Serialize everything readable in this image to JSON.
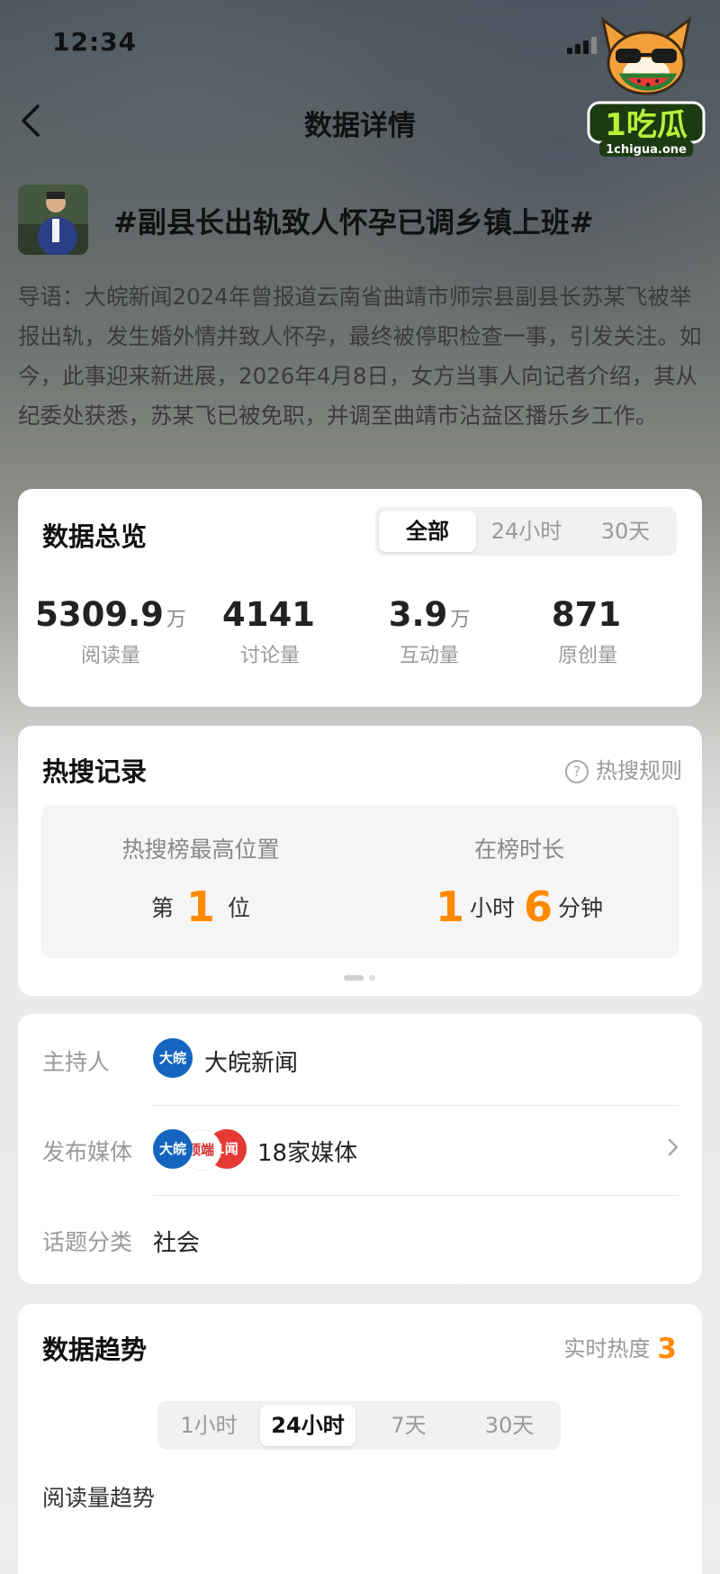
{
  "status_bar": {
    "time": "12:34"
  },
  "nav": {
    "title": "数据详情"
  },
  "logo": {
    "text": "1吃瓜",
    "subtext": "1chigua.one"
  },
  "topic": {
    "title": "#副县长出轨致人怀孕已调乡镇上班#",
    "intro": "导语：大皖新闻2024年曾报道云南省曲靖市师宗县副县长苏某飞被举报出轨，发生婚外情并致人怀孕，最终被停职检查一事，引发关注。如今，此事迎来新进展，2026年4月8日，女方当事人向记者介绍，其从纪委处获悉，苏某飞已被免职，并调至曲靖市沾益区播乐乡工作。"
  },
  "overview": {
    "title": "数据总览",
    "tabs": [
      "全部",
      "24小时",
      "30天"
    ],
    "active_tab": "全部",
    "stats": [
      {
        "value": "5309.9",
        "unit": "万",
        "label": "阅读量"
      },
      {
        "value": "4141",
        "unit": "",
        "label": "讨论量"
      },
      {
        "value": "3.9",
        "unit": "万",
        "label": "互动量"
      },
      {
        "value": "871",
        "unit": "",
        "label": "原创量"
      }
    ]
  },
  "hot_search": {
    "title": "热搜记录",
    "rule_label": "热搜规则",
    "highest_label": "热搜榜最高位置",
    "rank_prefix": "第",
    "rank": "1",
    "rank_suffix": "位",
    "duration_label": "在榜时长",
    "hours": "1",
    "hours_unit": "小时",
    "minutes": "6",
    "minutes_unit": "分钟"
  },
  "info": {
    "host_label": "主持人",
    "host_name": "大皖新闻",
    "media_label": "发布媒体",
    "media_count": "18家媒体",
    "category_label": "话题分类",
    "category": "社会",
    "media_logos": [
      "大皖",
      "顶端",
      "1闻"
    ]
  },
  "trend": {
    "title": "数据趋势",
    "realtime_label": "实时热度",
    "realtime_value": "3",
    "tabs": [
      "1小时",
      "24小时",
      "7天",
      "30天"
    ],
    "active_tab": "24小时",
    "chart_label": "阅读量趋势"
  },
  "colors": {
    "accent": "#ff8a00",
    "text": "#111111",
    "muted": "#999999"
  }
}
